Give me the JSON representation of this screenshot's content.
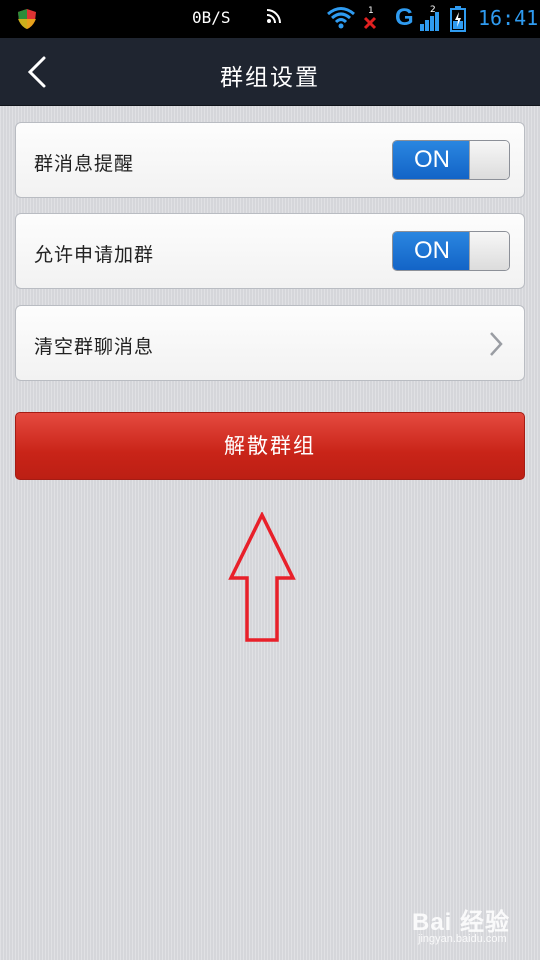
{
  "status_bar": {
    "speed": "0B/S",
    "network_type": "G",
    "time": "16:41",
    "icons": [
      "shield-icon",
      "rss-icon",
      "wifi-icon",
      "no-sim-icon",
      "signal-icon",
      "battery-charging-icon"
    ]
  },
  "header": {
    "title": "群组设置",
    "back_icon": "chevron-left-icon"
  },
  "settings": {
    "items": [
      {
        "label": "群消息提醒",
        "toggle": "ON"
      },
      {
        "label": "允许申请加群",
        "toggle": "ON"
      },
      {
        "label": "清空群聊消息",
        "icon": "chevron-right-icon"
      }
    ]
  },
  "actions": {
    "dissolve_label": "解散群组"
  },
  "annotation": {
    "icon": "up-arrow-icon",
    "color": "#e8202a"
  },
  "watermark": {
    "text": "Bai 经验",
    "sub": "jingyan.baidu.com"
  },
  "colors": {
    "title_bar": "#1f2530",
    "toggle_on": "#1c72d6",
    "danger_button": "#c92418",
    "status_accent": "#2f9bf0"
  }
}
